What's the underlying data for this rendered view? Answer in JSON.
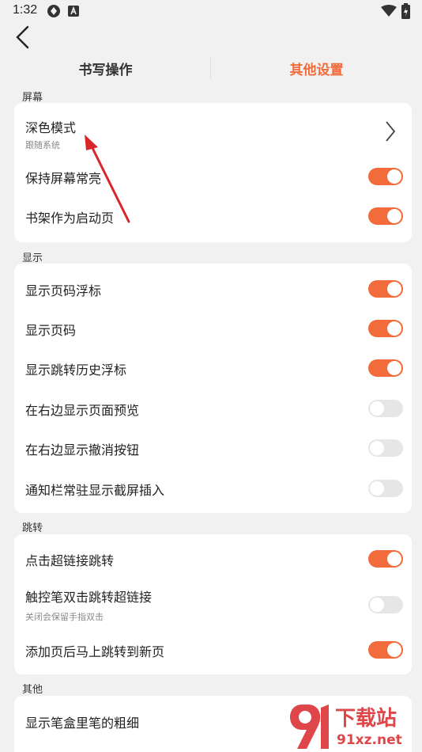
{
  "status_bar": {
    "time": "1:32"
  },
  "tabs": [
    {
      "label": "书写操作",
      "active": false
    },
    {
      "label": "其他设置",
      "active": true
    }
  ],
  "colors": {
    "accent": "#f26b3a",
    "toggle_off": "#e6e6e6",
    "arrow": "#d9262b"
  },
  "sections": {
    "screen": {
      "title": "屏幕",
      "dark_mode": {
        "label": "深色模式",
        "sub": "跟随系统"
      },
      "keep_screen_on": {
        "label": "保持屏幕常亮",
        "on": true
      },
      "bookshelf_start": {
        "label": "书架作为启动页",
        "on": true
      }
    },
    "display": {
      "title": "显示",
      "items": [
        {
          "label": "显示页码浮标",
          "on": true
        },
        {
          "label": "显示页码",
          "on": true
        },
        {
          "label": "显示跳转历史浮标",
          "on": true
        },
        {
          "label": "在右边显示页面预览",
          "on": false
        },
        {
          "label": "在右边显示撤消按钮",
          "on": false
        },
        {
          "label": "通知栏常驻显示截屏插入",
          "on": false
        }
      ]
    },
    "jump": {
      "title": "跳转",
      "items": [
        {
          "label": "点击超链接跳转",
          "on": true
        },
        {
          "label": "触控笔双击跳转超链接",
          "sub": "关闭会保留手指双击",
          "on": false
        },
        {
          "label": "添加页后马上跳转到新页",
          "on": true
        }
      ]
    },
    "other": {
      "title": "其他",
      "items": [
        {
          "label": "显示笔盒里笔的粗细"
        }
      ]
    }
  },
  "watermark": {
    "text": "下载站",
    "domain": "91xz.net"
  }
}
